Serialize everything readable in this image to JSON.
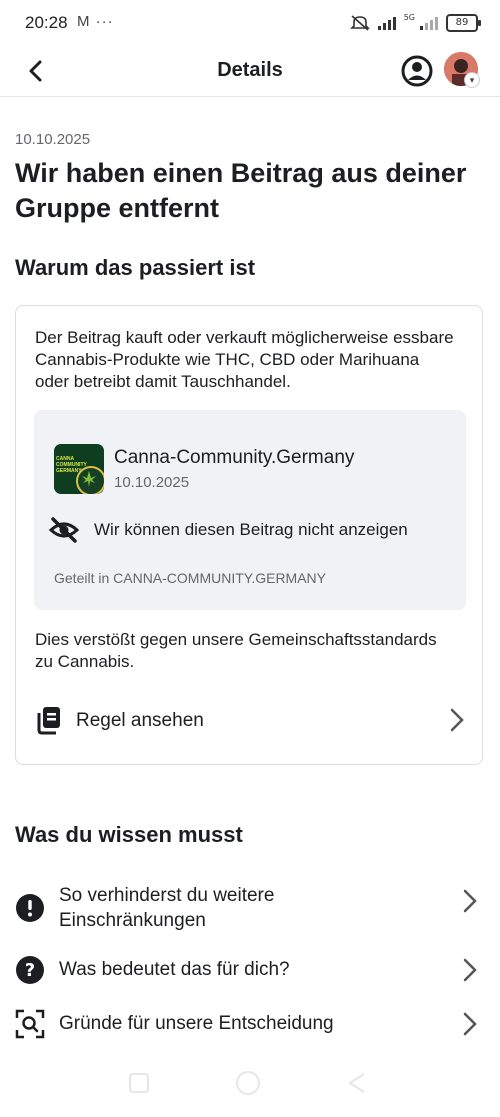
{
  "status_bar": {
    "time": "20:28",
    "left_icons": "M ···",
    "network_label": "5G",
    "battery": "89"
  },
  "nav": {
    "title": "Details",
    "back_icon": "back-arrow-icon",
    "profile_icon": "profile-circle-icon"
  },
  "notice": {
    "date": "10.10.2025",
    "headline": "Wir haben einen Beitrag aus deiner Gruppe entfernt",
    "why_heading": "Warum das passiert ist",
    "description": "Der Beitrag kauft oder verkauft möglicherweise essbare Cannabis-Produkte wie THC, CBD oder Marihuana oder betreibt damit Tauschhandel.",
    "post": {
      "group_name": "Canna-Community.Germany",
      "date": "10.10.2025",
      "thumb_text": "CANNA COMMUNITY GERMANY",
      "hidden_message": "Wir können diesen Beitrag nicht anzeigen",
      "shared_in": "Geteilt in CANNA-COMMUNITY.GERMANY"
    },
    "violation": "Dies verstößt gegen unsere Gemeinschaftsstandards zu Cannabis.",
    "rule_link": "Regel ansehen"
  },
  "know": {
    "heading": "Was du wissen musst",
    "items": [
      {
        "label": "So verhinderst du weitere Einschränkungen",
        "icon": "exclamation-icon"
      },
      {
        "label": "Was bedeutet das für dich?",
        "icon": "question-icon"
      },
      {
        "label": "Gründe für unsere Entscheidung",
        "icon": "scan-search-icon"
      }
    ]
  }
}
